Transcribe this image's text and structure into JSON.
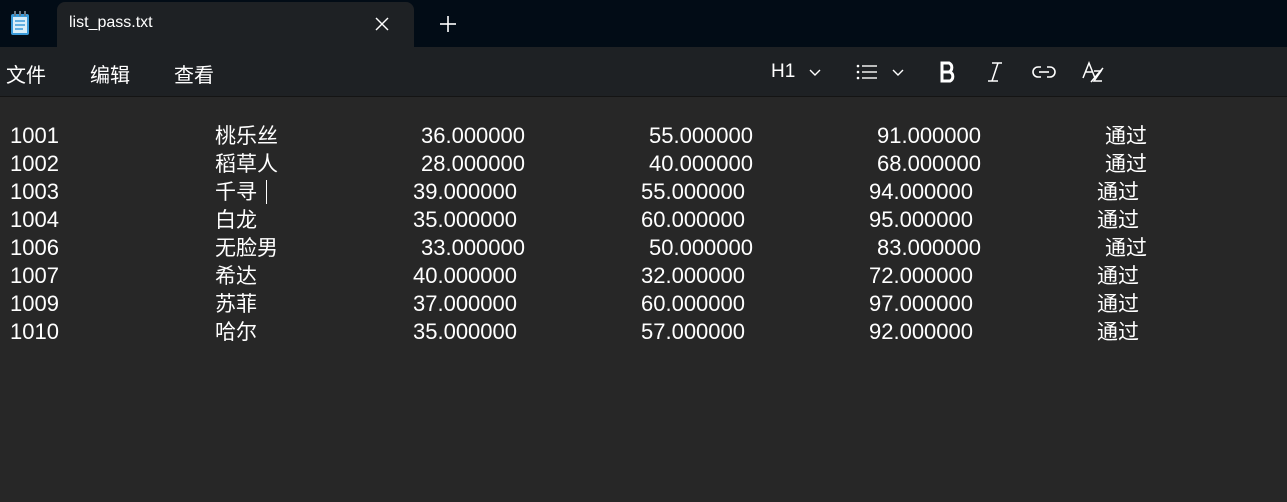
{
  "window": {
    "tab_title": "list_pass.txt",
    "app_icon": "notepad-icon",
    "close_icon": "close-icon",
    "new_tab_icon": "plus-icon"
  },
  "menu": {
    "items": [
      "文件",
      "编辑",
      "查看"
    ]
  },
  "toolbar": {
    "heading_label": "H1",
    "heading_icon": "chevron-down-icon",
    "list_icon": "bulleted-list-icon",
    "bold_icon": "bold-icon",
    "italic_icon": "italic-icon",
    "link_icon": "link-icon",
    "clear_format_icon": "clear-formatting-icon"
  },
  "rows": [
    [
      "1001",
      "桃乐丝",
      "36.000000",
      "55.000000",
      "91.000000",
      "通过"
    ],
    [
      "1002",
      "稻草人",
      "28.000000",
      "40.000000",
      "68.000000",
      "通过"
    ],
    [
      "1003",
      "千寻",
      "39.000000",
      "55.000000",
      "94.000000",
      "通过"
    ],
    [
      "1004",
      "白龙",
      "35.000000",
      "60.000000",
      "95.000000",
      "通过"
    ],
    [
      "1006",
      "无脸男",
      "33.000000",
      "50.000000",
      "83.000000",
      "通过"
    ],
    [
      "1007",
      "希达",
      "40.000000",
      "32.000000",
      "72.000000",
      "通过"
    ],
    [
      "1009",
      "苏菲",
      "37.000000",
      "60.000000",
      "97.000000",
      "通过"
    ],
    [
      "1010",
      "哈尔",
      "35.000000",
      "57.000000",
      "92.000000",
      "通过"
    ]
  ],
  "colors": {
    "titlebar_bg": "#020c16",
    "tab_bg": "#1e2124",
    "content_bg": "#272727",
    "text": "#ffffff"
  }
}
